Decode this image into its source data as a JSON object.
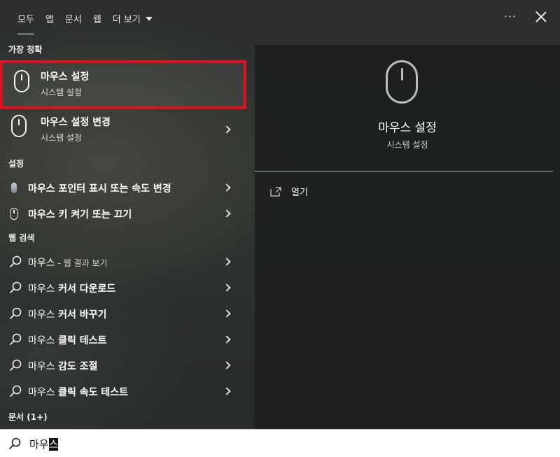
{
  "tabs": [
    "모두",
    "앱",
    "문서",
    "웹"
  ],
  "more_tab": "더 보기",
  "more_dots": "···",
  "sections": {
    "best": "가장 정확",
    "settings": "설정",
    "web": "웹 검색",
    "docs": "문서 (1+)"
  },
  "best_match": {
    "title": "마우스 설정",
    "subtitle": "시스템 설정"
  },
  "second_match": {
    "title": "마우스 설정 변경",
    "subtitle": "시스템 설정"
  },
  "settings_items": [
    "마우스 포인터 표시 또는 속도 변경",
    "마우스 키 켜기 또는 끄기"
  ],
  "web_items": [
    {
      "prefix": "마우스",
      "suffix": " - 웹 결과 보기",
      "bold": ""
    },
    {
      "prefix": "마우스 ",
      "bold": "커서 다운로드"
    },
    {
      "prefix": "마우스 ",
      "bold": "커서 바꾸기"
    },
    {
      "prefix": "마우스 ",
      "bold": "클릭 테스트"
    },
    {
      "prefix": "마우스 ",
      "bold": "감도 조절"
    },
    {
      "prefix": "마우스 ",
      "bold": "클릭 속도 테스트"
    }
  ],
  "preview": {
    "title": "마우스 설정",
    "subtitle": "시스템 설정",
    "open_label": "열기"
  },
  "search": {
    "typed": "마우",
    "selected": "스"
  },
  "colors": {
    "highlight_border": "#e01020",
    "search_bg": "#ffffff"
  },
  "icons": [
    "mouse-icon",
    "search-icon",
    "chevron-right-icon",
    "open-external-icon",
    "close-icon",
    "more-icon"
  ]
}
